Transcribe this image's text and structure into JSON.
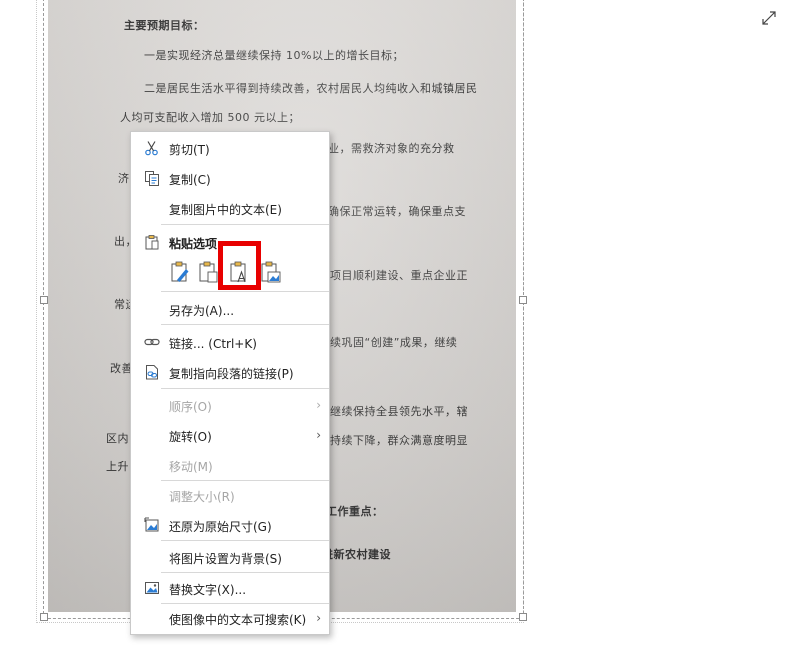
{
  "document": {
    "lines": [
      "主要预期目标：",
      "一是实现经济总量继续保持 10%以上的增长目标；",
      "二是居民生活水平得到持续改善，农村居民人均纯收入和城镇居民",
      "人均可支配收入增加 500 元以上；",
      "业，需救济对象的充分救",
      "济",
      "确保正常运转，确保重点支",
      "出，",
      "项目顺利建设、重点企业正",
      "常运",
      "续巩固“创建”成果，继续",
      "改善",
      "继续保持全县领先水平，辖",
      "区内",
      "持续下降，群众满意度明显",
      "上升",
      "工作重点：",
      "进新农村建设"
    ]
  },
  "context_menu": {
    "cut": "剪切(T)",
    "copy": "复制(C)",
    "copy_text_from_picture": "复制图片中的文本(E)",
    "paste_options": "粘贴选项:",
    "save_as": "另存为(A)...",
    "link": "链接... (Ctrl+K)",
    "copy_link_to_paragraph": "复制指向段落的链接(P)",
    "order": "顺序(O)",
    "rotate": "旋转(O)",
    "move": "移动(M)",
    "resize": "调整大小(R)",
    "reset_size": "还原为原始尺寸(G)",
    "set_as_background": "将图片设置为背景(S)",
    "alt_text": "替换文字(X)...",
    "make_text_searchable": "使图像中的文本可搜索(K)"
  },
  "icons": {
    "expand": "expand-icon",
    "cut": "scissors-icon",
    "copy": "copy-icon",
    "paste": "clipboard-icon",
    "link": "link-icon",
    "copy_link": "paragraph-link-icon",
    "reset": "reset-size-icon",
    "alt_text": "alt-text-icon",
    "submenu": "chevron-right-icon"
  },
  "colors": {
    "highlight": "#e80000",
    "accent": "#2b7cd3"
  }
}
